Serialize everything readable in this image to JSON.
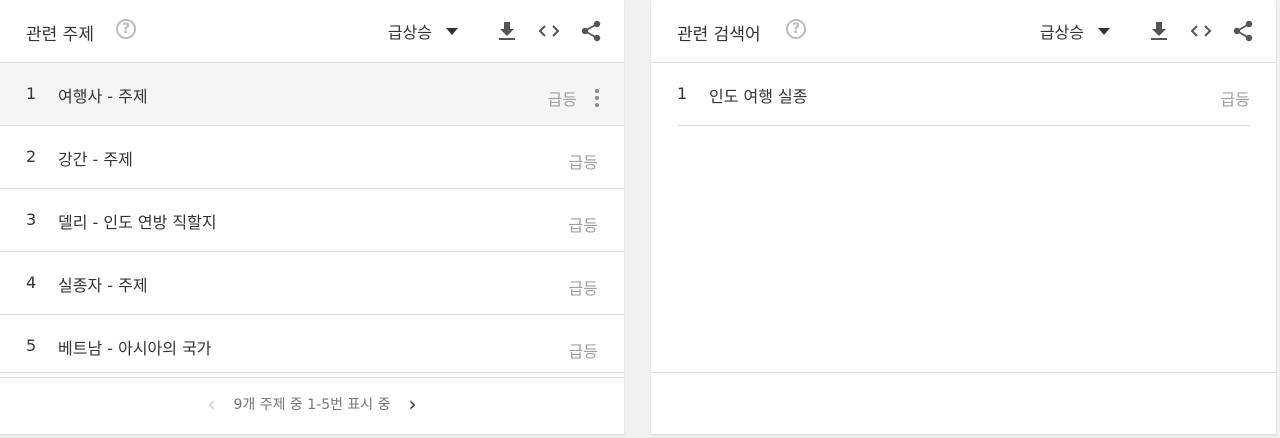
{
  "left_panel": {
    "title": "관련 주제",
    "help": "?",
    "sort_value": "급상승",
    "rows": [
      {
        "rank": "1",
        "text": "여행사 - 주제",
        "value": "급등"
      },
      {
        "rank": "2",
        "text": "강간 - 주제",
        "value": "급등"
      },
      {
        "rank": "3",
        "text": "델리 - 인도 연방 직할지",
        "value": "급등"
      },
      {
        "rank": "4",
        "text": "실종자 - 주제",
        "value": "급등"
      },
      {
        "rank": "5",
        "text": "베트남 - 아시아의 국가",
        "value": "급등"
      }
    ],
    "pagination": {
      "prev": "‹",
      "text": "9개 주제 중 1-5번 표시 중",
      "next": "›"
    }
  },
  "right_panel": {
    "title": "관련 검색어",
    "help": "?",
    "sort_value": "급상승",
    "rows": [
      {
        "rank": "1",
        "text": "인도 여행 실종",
        "value": "급등"
      }
    ]
  },
  "icons": {
    "help": "help-circle-icon",
    "caret": "caret-down-icon",
    "download": "download-icon",
    "embed": "code-embed-icon",
    "share": "share-icon",
    "more": "more-vert-icon"
  },
  "colors": {
    "text": "#333333",
    "muted": "#a0a0a0",
    "divider": "#e0e0e0",
    "background": "#f1f1f1"
  }
}
